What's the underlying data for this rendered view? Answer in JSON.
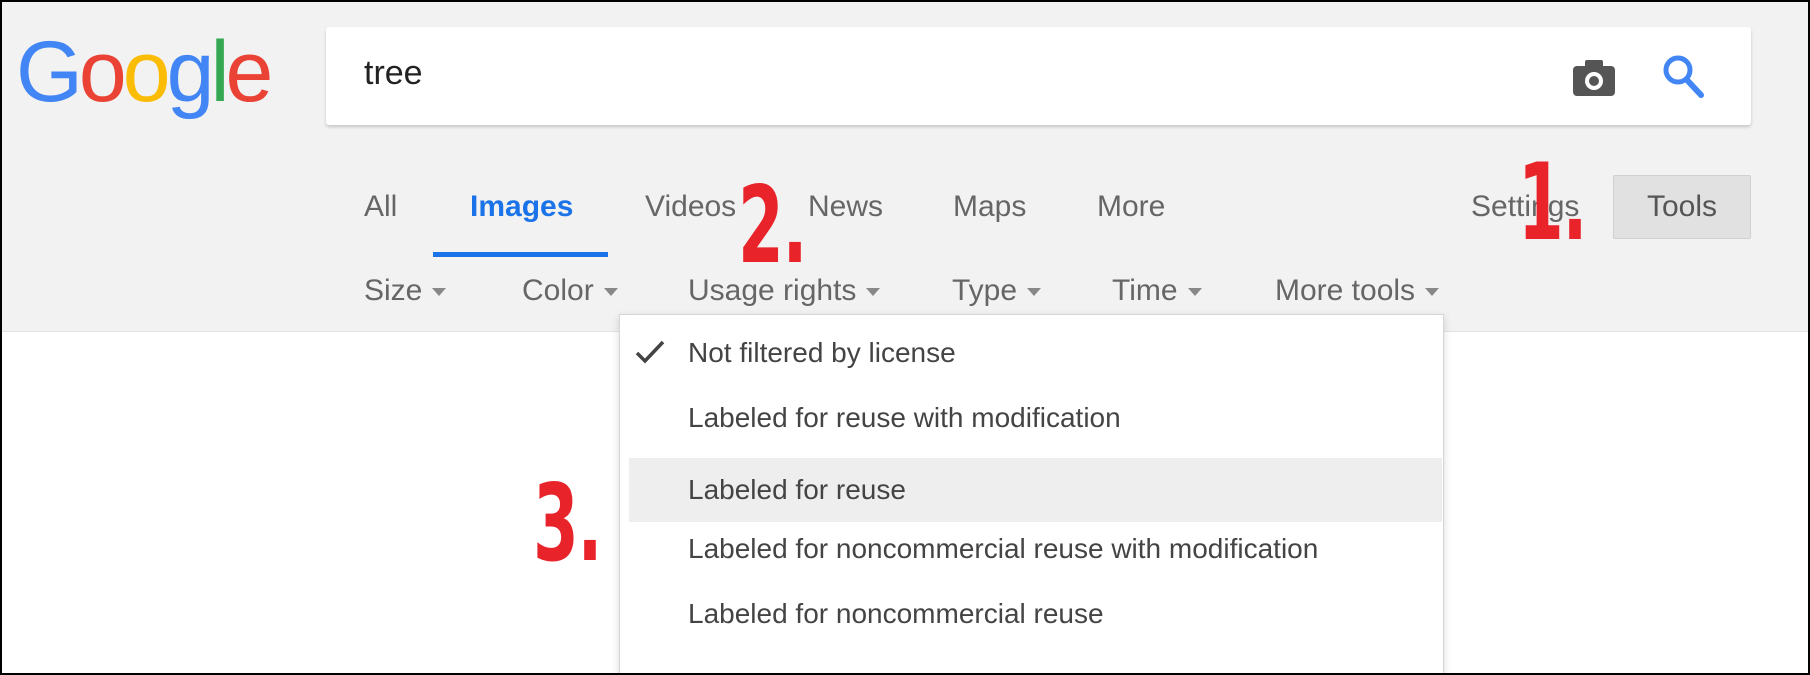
{
  "logo": {
    "letters": [
      {
        "ch": "G",
        "color": "#4285F4"
      },
      {
        "ch": "o",
        "color": "#EA4335"
      },
      {
        "ch": "o",
        "color": "#FBBC05"
      },
      {
        "ch": "g",
        "color": "#4285F4"
      },
      {
        "ch": "l",
        "color": "#34A853"
      },
      {
        "ch": "e",
        "color": "#EA4335"
      }
    ]
  },
  "search": {
    "value": "tree",
    "camera_icon": "camera-icon",
    "search_icon": "search-icon"
  },
  "tabs": [
    "All",
    "Images",
    "Videos",
    "News",
    "Maps",
    "More"
  ],
  "active_tab": "Images",
  "settings_label": "Settings",
  "tools_label": "Tools",
  "tool_filters": [
    "Size",
    "Color",
    "Usage rights",
    "Type",
    "Time",
    "More tools"
  ],
  "usage_rights_menu": {
    "items": [
      "Not filtered by license",
      "Labeled for reuse with modification",
      "Labeled for reuse",
      "Labeled for noncommercial reuse with modification",
      "Labeled for noncommercial reuse"
    ],
    "checked_item": "Not filtered by license",
    "highlighted_item": "Labeled for reuse"
  },
  "annotations": [
    "1.",
    "2.",
    "3."
  ],
  "colors": {
    "accent": "#1a73e8",
    "annotation_red": "#e8232a",
    "header_bg": "#f2f2f2"
  }
}
